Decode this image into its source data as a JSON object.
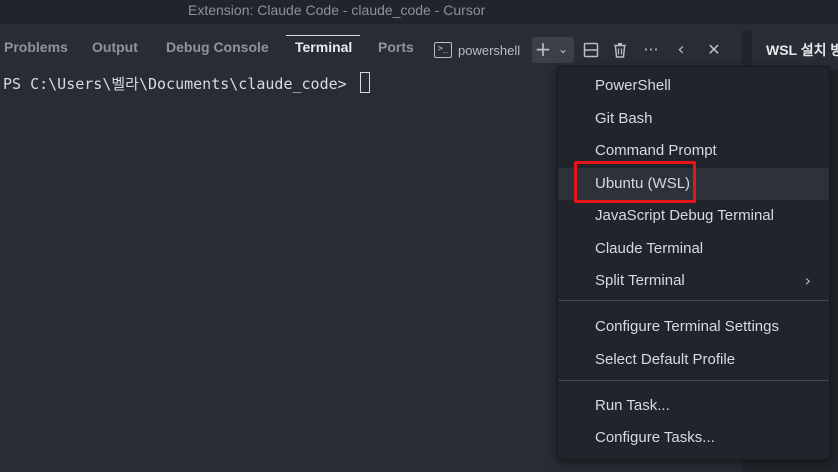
{
  "window": {
    "title": "Extension: Claude Code - claude_code - Cursor"
  },
  "panel": {
    "tabs": [
      {
        "label": "Problems"
      },
      {
        "label": "Output"
      },
      {
        "label": "Debug Console"
      },
      {
        "label": "Terminal"
      },
      {
        "label": "Ports"
      }
    ],
    "active_tab": "Terminal"
  },
  "terminal_profile": {
    "label": "powershell",
    "icon_glyph": ">_"
  },
  "controls": {
    "plus_icon": "plus-icon",
    "dropdown_icon": "chevron-down-icon",
    "split_icon": "split-icon",
    "trash_icon": "trash-icon",
    "more_icon": "more-icon",
    "back_icon": "chevron-left-icon",
    "close_icon": "close-icon"
  },
  "editor_tab": {
    "label": "WSL 설치 방"
  },
  "terminal": {
    "prompt": "PS C:\\Users\\벨라\\Documents\\claude_code> "
  },
  "menu": {
    "groups": [
      [
        "PowerShell",
        "Git Bash",
        "Command Prompt",
        "Ubuntu (WSL)",
        "JavaScript Debug Terminal",
        "Claude Terminal",
        "Split Terminal"
      ],
      [
        "Configure Terminal Settings",
        "Select Default Profile"
      ],
      [
        "Run Task...",
        "Configure Tasks..."
      ]
    ],
    "highlighted_item": "Ubuntu (WSL)",
    "submenu_item": "Split Terminal"
  },
  "colors": {
    "background": "#282c34",
    "menu_background": "#21252b",
    "highlight_border": "#e8131b"
  }
}
